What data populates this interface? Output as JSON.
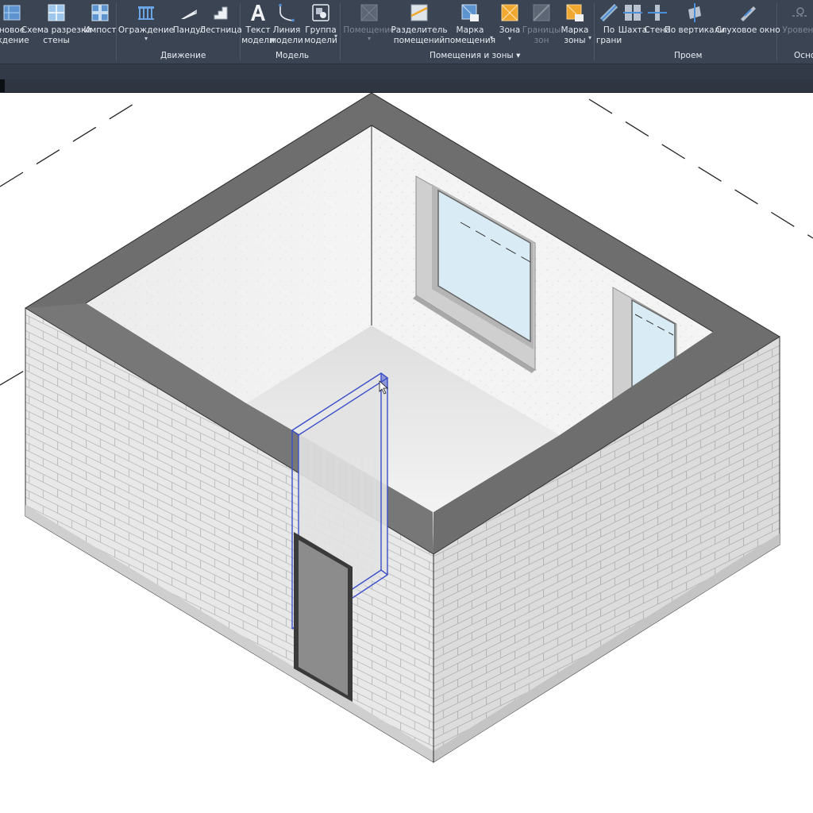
{
  "ribbon": {
    "panels": {
      "movement": "Движение",
      "model": "Модель",
      "rooms": "Помещения и зоны",
      "rooms_caret": "▾",
      "opening": "Проем",
      "basis": "Осно"
    },
    "tools": {
      "floor": "новое\nждение",
      "curtain_grid": "Схема разрезки\nстены",
      "mullion": "Импост",
      "railing": "Ограждение",
      "ramp": "Пандус",
      "stair": "Лестница",
      "model_text": "Текст\nмодели",
      "model_line": "Линия\nмодели",
      "model_group": "Группа\nмодели",
      "room": "Помещение",
      "room_separator": "Разделитель\nпомещений",
      "room_tag": "Марка\nпомещения",
      "area": "Зона",
      "area_boundary": "Границы\nзон",
      "area_tag": "Марка\nзоны",
      "by_face": "По\nграни",
      "shaft": "Шахта",
      "wall_opening": "Стена",
      "vertical": "По вертикали",
      "dormer": "Слуховое окно",
      "level": "Уровень"
    },
    "colors": {
      "ribbon_bg": "#3b4453",
      "label": "#e8ecf2",
      "disabled": "#7d8694",
      "accent_blue": "#4a8fd8",
      "accent_orange": "#f0a830"
    }
  },
  "viewport": {
    "colors": {
      "wall_top": "#6e6e6e",
      "brick_left": "#e6e6e6",
      "brick_right": "#d8d8d8",
      "interior_wall": "#f4f4f4",
      "floor": "#ececec",
      "glass": "#d9ecf5",
      "door": "#8c8c8c",
      "selection": "#3a4ec8"
    }
  }
}
